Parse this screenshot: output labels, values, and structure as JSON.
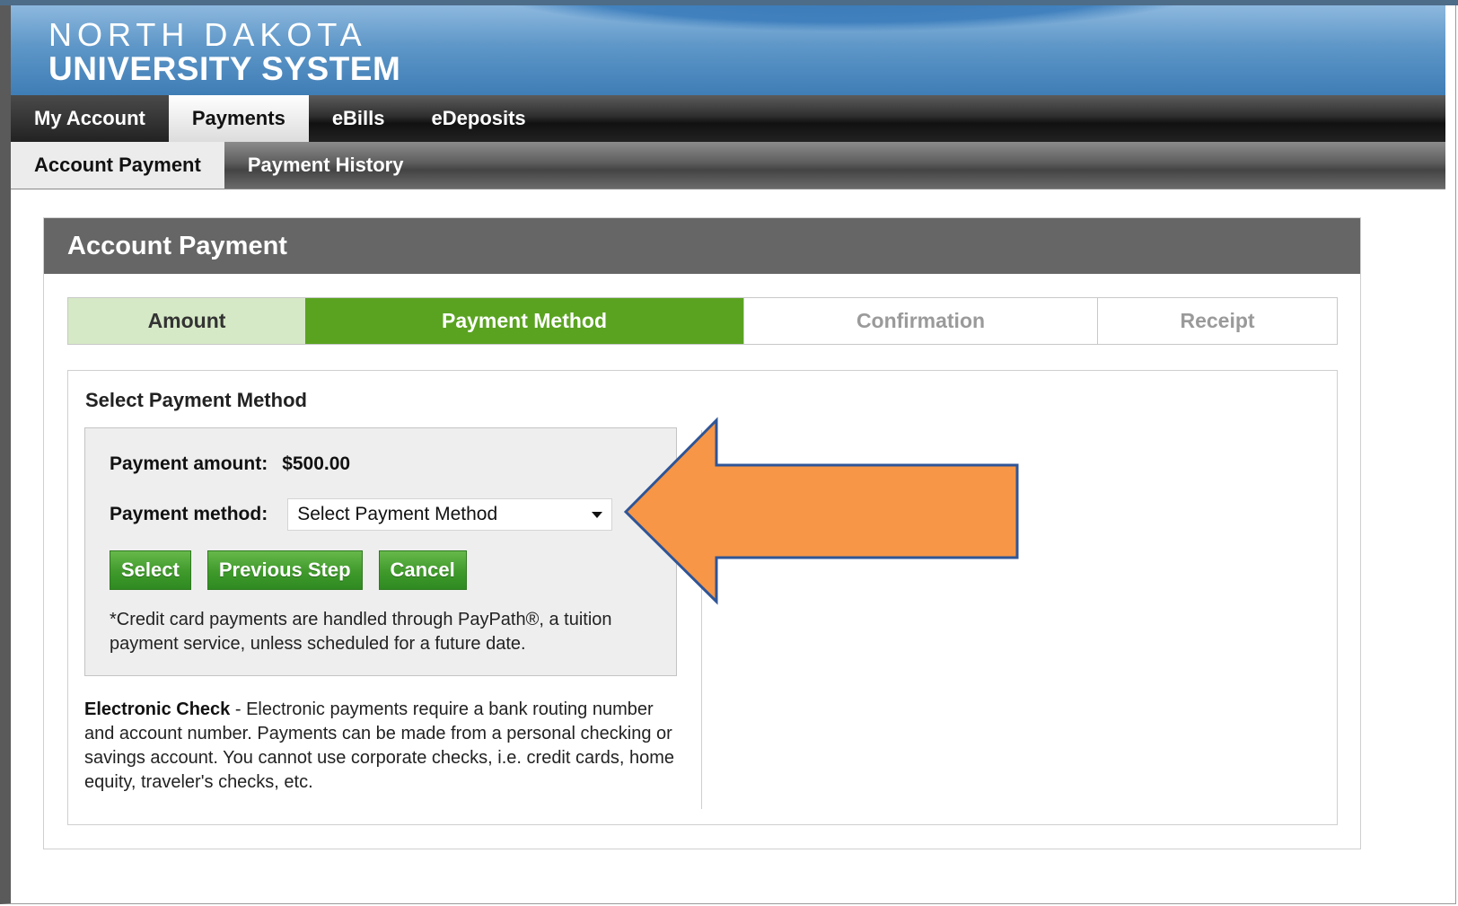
{
  "header": {
    "logo_line1": "NORTH DAKOTA",
    "logo_line2": "UNIVERSITY SYSTEM"
  },
  "nav_main": {
    "tabs": [
      {
        "label": "My Account"
      },
      {
        "label": "Payments",
        "active": true
      },
      {
        "label": "eBills"
      },
      {
        "label": "eDeposits"
      }
    ]
  },
  "nav_sub": {
    "tabs": [
      {
        "label": "Account Payment",
        "active": true
      },
      {
        "label": "Payment History"
      }
    ]
  },
  "panel": {
    "title": "Account Payment",
    "steps": [
      {
        "label": "Amount",
        "state": "done"
      },
      {
        "label": "Payment Method",
        "state": "current"
      },
      {
        "label": "Confirmation",
        "state": "todo"
      },
      {
        "label": "Receipt",
        "state": "todo"
      }
    ],
    "section_title": "Select Payment Method",
    "form": {
      "amount_label": "Payment amount:",
      "amount_value": "$500.00",
      "method_label": "Payment method:",
      "method_selected": "Select Payment Method",
      "buttons": {
        "select": "Select",
        "previous": "Previous Step",
        "cancel": "Cancel"
      },
      "note": "*Credit card payments are handled through PayPath®, a tuition payment service, unless scheduled for a future date."
    },
    "echeck": {
      "title": "Electronic Check",
      "text": " - Electronic payments require a bank routing number and account number. Payments can be made from a personal checking or savings account. You cannot use corporate checks, i.e. credit cards, home equity, traveler's checks, etc."
    }
  },
  "colors": {
    "step_current": "#5aa321",
    "step_done": "#d6e9c6",
    "button_green": "#3f9a2b",
    "arrow_fill": "#f79646",
    "arrow_stroke": "#2f5597",
    "panel_header": "#666666"
  }
}
